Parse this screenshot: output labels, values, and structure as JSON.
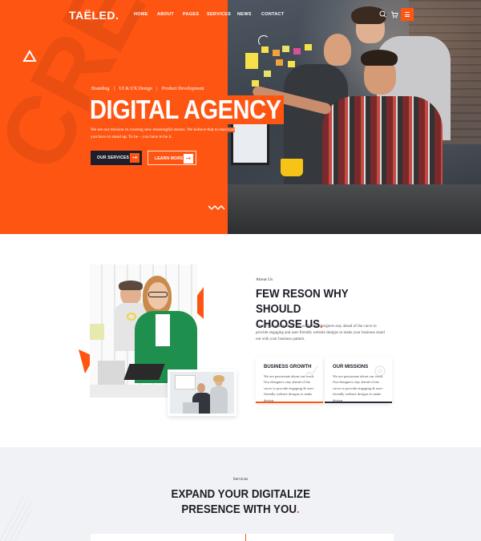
{
  "brand": {
    "logo": "TAËLED."
  },
  "nav": {
    "items": [
      {
        "label": "HOME",
        "id": "home"
      },
      {
        "label": "ABOUT",
        "id": "about"
      },
      {
        "label": "PAGES",
        "id": "pages"
      },
      {
        "label": "SERVICES",
        "id": "services"
      },
      {
        "label": "NEWS",
        "id": "news"
      },
      {
        "label": "CONTACT",
        "id": "contact"
      }
    ],
    "icons": [
      "search-icon",
      "cart-icon",
      "menu-icon"
    ]
  },
  "hero": {
    "ghost_text": "CREATIV",
    "tags": [
      "Branding",
      "|",
      "UI & UX Design",
      "|",
      "Product Development"
    ],
    "title": "DIGITAL AGENCY",
    "description_line1": "We are our mission in creating new meaningful stories. We believe that to stand out",
    "description_line2": "you have to stand up. To be – you have to be it.",
    "primary_button": "OUR SERVICES",
    "secondary_button": "LEARN MORE"
  },
  "about": {
    "label": "About Us",
    "title_line1": "FEW RESON WHY SHOULD",
    "title_line2": "CHOOSE US",
    "title_dot": ".",
    "description": "We are passionate about our work. Our designers stay ahead of the curve to provide engaging and user-friendly website designs to make your business stand out with your business pattern.",
    "cards": [
      {
        "title": "BUSINESS GROWTH",
        "text": "We are passionate about our work. Our designers stay ahead of the curve to provide engaging & user-friendly website designs to make design."
      },
      {
        "title": "OUR MISSIONS",
        "text": "We are passionate about our work. Our designers stay ahead of the curve to provide engaging & user-friendly website designs to make design."
      }
    ]
  },
  "services": {
    "label": "Services",
    "title_line1": "EXPAND YOUR DIGITALIZE",
    "title_line2": "PRESENCE WITH YOU",
    "title_dot": "."
  },
  "colors": {
    "accent": "#ff5513",
    "dark": "#1f1f2b",
    "light_bg": "#f1f2f5"
  }
}
